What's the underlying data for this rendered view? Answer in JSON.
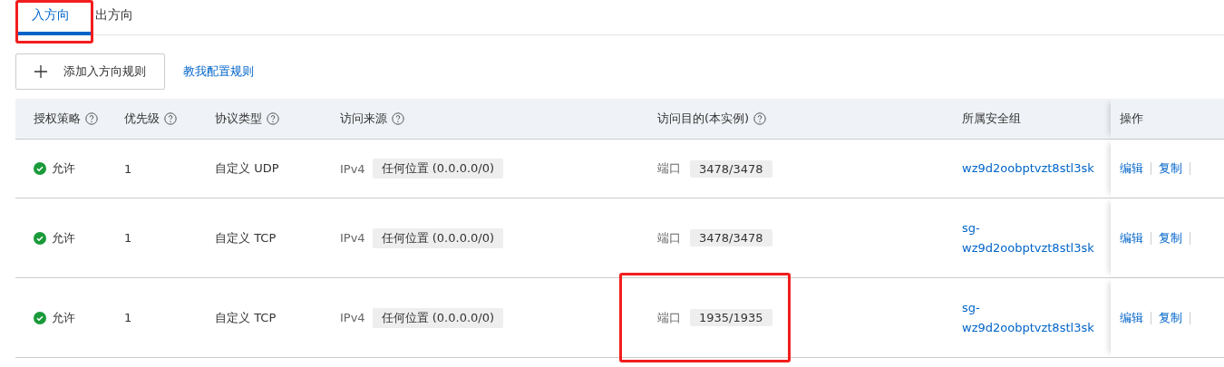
{
  "tabs": [
    {
      "label": "入方向",
      "selected": true,
      "highlighted": true
    },
    {
      "label": "出方向",
      "selected": false,
      "highlighted": false
    }
  ],
  "toolbar": {
    "add_button": "添加入方向规则",
    "help_link": "教我配置规则"
  },
  "table": {
    "columns": [
      {
        "label": "授权策略",
        "help": true
      },
      {
        "label": "优先级",
        "help": true
      },
      {
        "label": "协议类型",
        "help": true
      },
      {
        "label": "访问来源",
        "help": true
      },
      {
        "label": "访问目的(本实例)",
        "help": true
      },
      {
        "label": "所属安全组",
        "help": false
      },
      {
        "label": "操作",
        "help": false
      }
    ],
    "rows": [
      {
        "policy": "允许",
        "priority": "1",
        "protocol": "自定义 UDP",
        "ip_version": "IPv4",
        "source": "任何位置 (0.0.0.0/0)",
        "dest_label": "端口",
        "dest": "3478/3478",
        "dest_highlighted": false,
        "group": [
          "wz9d2oobptvzt8stl3sk"
        ],
        "actions": [
          "编辑",
          "复制"
        ]
      },
      {
        "policy": "允许",
        "priority": "1",
        "protocol": "自定义 TCP",
        "ip_version": "IPv4",
        "source": "任何位置 (0.0.0.0/0)",
        "dest_label": "端口",
        "dest": "3478/3478",
        "dest_highlighted": false,
        "group": [
          "sg-",
          "wz9d2oobptvzt8stl3sk"
        ],
        "actions": [
          "编辑",
          "复制"
        ]
      },
      {
        "policy": "允许",
        "priority": "1",
        "protocol": "自定义 TCP",
        "ip_version": "IPv4",
        "source": "任何位置 (0.0.0.0/0)",
        "dest_label": "端口",
        "dest": "1935/1935",
        "dest_highlighted": true,
        "group": [
          "sg-",
          "wz9d2oobptvzt8stl3sk"
        ],
        "actions": [
          "编辑",
          "复制"
        ]
      }
    ]
  }
}
